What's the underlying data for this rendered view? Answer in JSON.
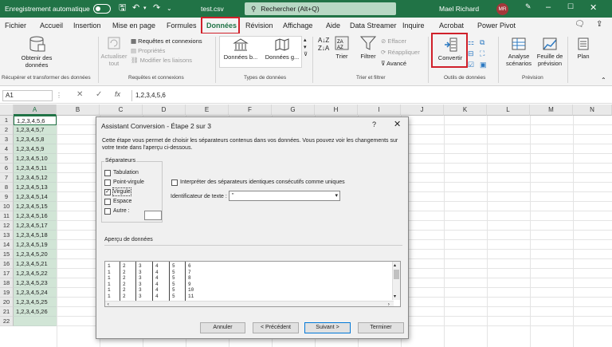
{
  "titlebar": {
    "autosave_label": "Enregistrement automatique",
    "file_name": "test.csv",
    "search_placeholder": "Rechercher (Alt+Q)",
    "user_name": "Mael Richard",
    "user_initials": "MR"
  },
  "menu": {
    "tabs": [
      "Fichier",
      "Accueil",
      "Insertion",
      "Mise en page",
      "Formules",
      "Données",
      "Révision",
      "Affichage",
      "Aide",
      "Data Streamer",
      "Inquire",
      "Acrobat",
      "Power Pivot"
    ],
    "active_tab": "Données"
  },
  "ribbon": {
    "get_data_label": "Obtenir des données",
    "refresh_all_label": "Actualiser tout",
    "queries_connections": "Requêtes et connexions",
    "properties": "Propriétés",
    "edit_links": "Modifier les liaisons",
    "data_types_1": "Données b...",
    "data_types_2": "Données g...",
    "sort_label": "Trier",
    "filter_label": "Filtrer",
    "clear_label": "Effacer",
    "reapply_label": "Réappliquer",
    "advanced_label": "Avancé",
    "convert_label": "Convertir",
    "whatif_label": "Analyse scénarios",
    "forecast_label": "Feuille de prévision",
    "outline_label": "Plan",
    "groups": {
      "get_transform": "Récupérer et transformer des données",
      "queries": "Requêtes et connexions",
      "data_types": "Types de données",
      "sort_filter": "Trier et filtrer",
      "data_tools": "Outils de données",
      "forecast": "Prévision"
    }
  },
  "formula_bar": {
    "cell_ref": "A1",
    "formula": "1,2,3,4,5,6"
  },
  "sheet": {
    "columns": [
      "A",
      "B",
      "C",
      "D",
      "E",
      "F",
      "G",
      "H",
      "I",
      "J",
      "K",
      "L",
      "M",
      "N"
    ],
    "rows": [
      "1",
      "2",
      "3",
      "4",
      "5",
      "6",
      "7",
      "8",
      "9",
      "10",
      "11",
      "12",
      "13",
      "14",
      "15",
      "16",
      "17",
      "18",
      "19",
      "20",
      "21",
      "22"
    ],
    "cells": [
      "1,2,3,4,5,6",
      "1,2,3,4,5,7",
      "1,2,3,4,5,8",
      "1,2,3,4,5,9",
      "1,2,3,4,5,10",
      "1,2,3,4,5,11",
      "1,2,3,4,5,12",
      "1,2,3,4,5,13",
      "1,2,3,4,5,14",
      "1,2,3,4,5,15",
      "1,2,3,4,5,16",
      "1,2,3,4,5,17",
      "1,2,3,4,5,18",
      "1,2,3,4,5,19",
      "1,2,3,4,5,20",
      "1,2,3,4,5,21",
      "1,2,3,4,5,22",
      "1,2,3,4,5,23",
      "1,2,3,4,5,24",
      "1,2,3,4,5,25",
      "1,2,3,4,5,26",
      ""
    ]
  },
  "dialog": {
    "title": "Assistant Conversion - Étape 2 sur 3",
    "help": "?",
    "close": "✕",
    "description": "Cette étape vous permet de choisir les séparateurs contenus dans vos données. Vous pouvez voir les changements sur votre texte dans l'aperçu ci-dessous.",
    "separators_legend": "Séparateurs",
    "separators": [
      {
        "label": "Tabulation",
        "checked": false
      },
      {
        "label": "Point-virgule",
        "checked": false
      },
      {
        "label": "Virgule",
        "checked": true
      },
      {
        "label": "Espace",
        "checked": false
      },
      {
        "label": "Autre :",
        "checked": false
      }
    ],
    "consecutive_label": "Interpréter des séparateurs identiques consécutifs comme uniques",
    "qualifier_label": "Identificateur de texte :",
    "qualifier_value": "\"",
    "preview_label": "Aperçu de données",
    "preview_rows": [
      [
        "1",
        "2",
        "3",
        "4",
        "5",
        "6"
      ],
      [
        "1",
        "2",
        "3",
        "4",
        "5",
        "7"
      ],
      [
        "1",
        "2",
        "3",
        "4",
        "5",
        "8"
      ],
      [
        "1",
        "2",
        "3",
        "4",
        "5",
        "9"
      ],
      [
        "1",
        "2",
        "3",
        "4",
        "5",
        "10"
      ],
      [
        "1",
        "2",
        "3",
        "4",
        "5",
        "11"
      ]
    ],
    "buttons": {
      "cancel": "Annuler",
      "prev": "< Précédent",
      "next": "Suivant >",
      "finish": "Terminer"
    }
  },
  "colors": {
    "excel_green": "#217346",
    "highlight_red": "#d0202a"
  }
}
